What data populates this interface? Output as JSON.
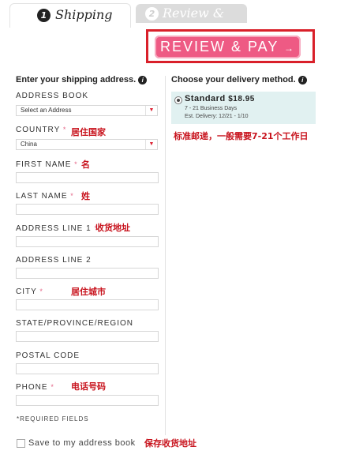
{
  "tabs": [
    {
      "number": "1",
      "label": "Shipping"
    },
    {
      "number": "2",
      "label": "Review & Pay"
    }
  ],
  "review_button": {
    "label": "REVIEW & PAY",
    "arrow": "→"
  },
  "left_title": "Enter your shipping address.",
  "right_title": "Choose your delivery method.",
  "info_icon_glyph": "i",
  "fields": {
    "address_book": {
      "label": "ADDRESS BOOK",
      "value": "Select an Address"
    },
    "country": {
      "label": "COUNTRY",
      "required_mark": "*",
      "value": "China",
      "note": "居住国家"
    },
    "first_name": {
      "label": "FIRST NAME",
      "required_mark": "*",
      "note": "名"
    },
    "last_name": {
      "label": "LAST NAME",
      "required_mark": "*",
      "note": "姓"
    },
    "address1": {
      "label": "ADDRESS LINE 1",
      "required_mark": "*",
      "note": "收货地址"
    },
    "address2": {
      "label": "ADDRESS LINE 2"
    },
    "city": {
      "label": "CITY",
      "required_mark": "*",
      "note": "居住城市"
    },
    "state": {
      "label": "STATE/PROVINCE/REGION"
    },
    "postal": {
      "label": "POSTAL CODE"
    },
    "phone": {
      "label": "PHONE",
      "required_mark": "*",
      "note": "电话号码"
    }
  },
  "required_note": "*REQUIRED FIELDS",
  "save_checkbox": {
    "label": "Save to my address book",
    "note": "保存收货地址",
    "checked": false
  },
  "delivery": {
    "name": "Standard",
    "price": "$18.95",
    "days": "7 - 21 Business Days",
    "est": "Est. Delivery: 12/21 - 1/10",
    "note": "标准邮递，一般需要7-21个工作日"
  },
  "colors": {
    "accent": "#ee5a84",
    "highlight_border": "#d9202a",
    "annotation": "#c8141e",
    "delivery_bg": "#e1f1f1"
  }
}
